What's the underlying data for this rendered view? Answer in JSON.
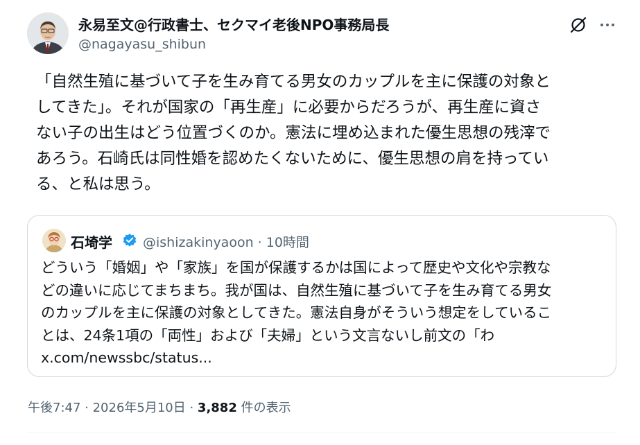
{
  "author": {
    "display_name": "永易至文@行政書士、セクマイ老後NPO事務局長",
    "handle": "@nagayasu_shibun"
  },
  "icons": {
    "grok": "grok-icon",
    "more": "more-options-icon",
    "verified": "verified-badge-icon"
  },
  "tweet": {
    "text": "「自然生殖に基づいて子を生み育てる男女のカップルを主に保護の対象と\nしてきた」。それが国家の「再生産」に必要からだろうが、再生産に資さ\nない子の出生はどう位置づくのか。憲法に埋め込まれた優生思想の残滓で\nあろう。石崎氏は同性婚を認めたくないために、優生思想の肩を持ってい\nる、と私は思う。"
  },
  "quoted": {
    "display_name": "石埼学",
    "handle_time": "@ishizakinyaoon · 10時間",
    "text": "どういう「婚姻」や「家族」を国が保護するかは国によって歴史や文化や宗教な\nどの違いに応じてまちまち。我が国は、自然生殖に基づいて子を生み育てる男女\nのカップルを主に保護の対象としてきた。憲法自身がそういう想定をしているこ\nとは、24条1項の「両性」および「夫婦」という文言ないし前文の「わ\nx.com/newssbc/status..."
  },
  "meta": {
    "time_date": "午後7:47 · 2026年5月10日 · ",
    "views_count": "3,882",
    "views_label": " 件の表示"
  },
  "colors": {
    "text": "#0f1419",
    "secondary": "#536471",
    "border": "#cfd9de",
    "verified": "#1d9bf0"
  }
}
